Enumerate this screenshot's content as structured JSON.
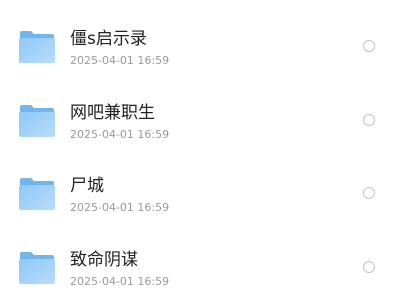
{
  "files": [
    {
      "name": "僵s启示录",
      "date": "2025-04-01 16:59",
      "icon": "folder-icon",
      "selected": false
    },
    {
      "name": "网吧兼职生",
      "date": "2025-04-01 16:59",
      "icon": "folder-icon",
      "selected": false
    },
    {
      "name": "尸城",
      "date": "2025-04-01 16:59",
      "icon": "folder-icon",
      "selected": false
    },
    {
      "name": "致命阴谋",
      "date": "2025-04-01 16:59",
      "icon": "folder-icon",
      "selected": false
    }
  ],
  "colors": {
    "folder_back": "#6fb6ef",
    "folder_front": "#a9d4f8",
    "name_text": "#222222",
    "date_text": "#9a9a9a",
    "radio_border": "#c4c4c4"
  }
}
